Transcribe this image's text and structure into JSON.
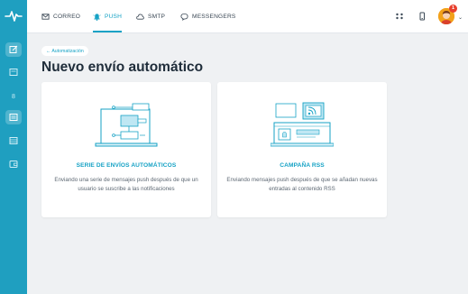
{
  "topbar": {
    "tabs": [
      {
        "label": "CORREO",
        "icon": "mail-icon"
      },
      {
        "label": "PUSH",
        "icon": "bell-icon",
        "active": true
      },
      {
        "label": "SMTP",
        "icon": "cloud-icon"
      },
      {
        "label": "MESSENGERS",
        "icon": "chat-icon"
      }
    ],
    "notification_count": "1"
  },
  "breadcrumb": "← Automatización",
  "page_title": "Nuevo envío automático",
  "cards": [
    {
      "title": "SERIE DE ENVÍOS AUTOMÁTICOS",
      "description": "Enviando una serie de mensajes push después de que un usuario se suscribe a las notificaciones"
    },
    {
      "title": "CAMPAÑA RSS",
      "description": "Enviando mensajes push después de que se añadan nuevas entradas al contenido RSS"
    }
  ],
  "colors": {
    "accent": "#16a2c5",
    "sidebar": "#1f9fc0",
    "background": "#eff1f3"
  }
}
